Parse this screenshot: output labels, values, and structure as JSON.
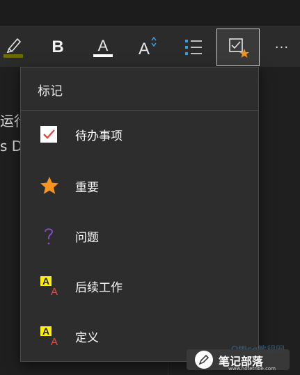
{
  "toolbar": {
    "bold_label": "B",
    "font_color_label": "A",
    "font_size_label": "A",
    "more_label": "···"
  },
  "page": {
    "line1": "运行",
    "line2": "s D"
  },
  "tags_menu": {
    "header": "标记",
    "items": [
      {
        "label": "待办事项",
        "icon": "checkbox-checked-icon"
      },
      {
        "label": "重要",
        "icon": "star-icon"
      },
      {
        "label": "问题",
        "icon": "question-mark-icon"
      },
      {
        "label": "后续工作",
        "icon": "follow-up-icon"
      },
      {
        "label": "定义",
        "icon": "definition-icon"
      }
    ],
    "follow_up_glyphs": [
      "A",
      "A"
    ],
    "definition_glyphs": [
      "A",
      "A"
    ]
  },
  "watermark": {
    "text": "笔记部落",
    "sub": "www.notetribe.com",
    "faint": "Office教程网"
  },
  "colors": {
    "accent_star": "#f7941d",
    "check_red": "#e04b3f",
    "question_purple": "#8a4fc8",
    "highlight_yellow": "#fff200",
    "font_red": "#e0524a",
    "list_blue": "#3b9ddd"
  }
}
